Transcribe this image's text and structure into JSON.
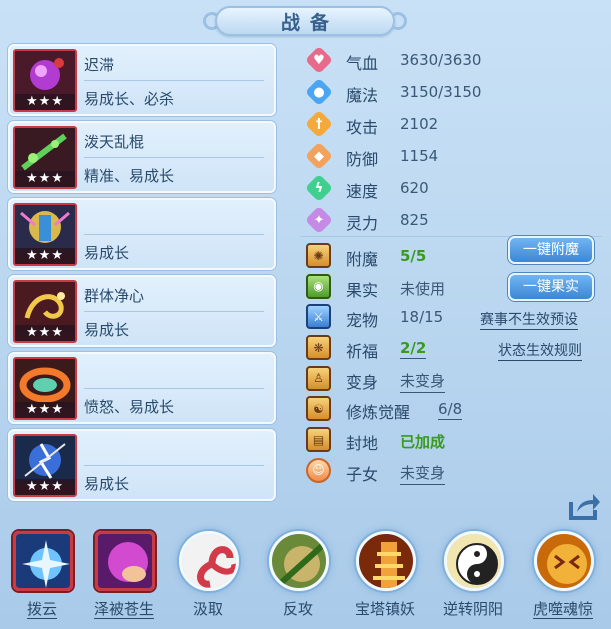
{
  "title": "战备",
  "skills": [
    {
      "name": "迟滞",
      "desc": "易成长、必杀",
      "stars": "★★★",
      "icon": "purple-orb-icon"
    },
    {
      "name": "泼天乱棍",
      "desc": "精准、易成长",
      "stars": "★★★",
      "icon": "green-staff-icon"
    },
    {
      "name": "",
      "desc": "易成长",
      "stars": "★★★",
      "icon": "armored-warrior-icon"
    },
    {
      "name": "群体净心",
      "desc": "易成长",
      "stars": "★★★",
      "icon": "golden-dragon-icon"
    },
    {
      "name": "",
      "desc": "愤怒、易成长",
      "stars": "★★★",
      "icon": "fire-ring-icon"
    },
    {
      "name": "",
      "desc": "易成长",
      "stars": "★★★",
      "icon": "lightning-figure-icon"
    }
  ],
  "stats": [
    {
      "label": "气血",
      "value": "3630/3630",
      "icon": "heart-icon",
      "color": "#e86a8a"
    },
    {
      "label": "魔法",
      "value": "3150/3150",
      "icon": "mana-icon",
      "color": "#4aa6f2"
    },
    {
      "label": "攻击",
      "value": "2102",
      "icon": "sword-icon",
      "color": "#f4a93a"
    },
    {
      "label": "防御",
      "value": "1154",
      "icon": "shield-icon",
      "color": "#f2a25a"
    },
    {
      "label": "速度",
      "value": "620",
      "icon": "lightning-icon",
      "color": "#3fcf8e"
    },
    {
      "label": "灵力",
      "value": "825",
      "icon": "spirit-icon",
      "color": "#c48ae6"
    }
  ],
  "extras": {
    "fumo": {
      "label": "附魔",
      "value": "5/5"
    },
    "guoshi": {
      "label": "果实",
      "value": "未使用"
    },
    "chongwu": {
      "label": "宠物",
      "value": "18/15"
    },
    "qifu": {
      "label": "祈福",
      "value": "2/2"
    },
    "bianshen": {
      "label": "变身",
      "value": "未变身"
    },
    "xiulian": {
      "label": "修炼觉醒",
      "value": "6/8"
    },
    "fengdi": {
      "label": "封地",
      "value": "已加成"
    },
    "zinv": {
      "label": "子女",
      "value": "未变身"
    }
  },
  "buttons": {
    "fumo": "一键附魔",
    "guoshi": "一键果实"
  },
  "links": {
    "preset": "赛事不生效预设",
    "rules": "状态生效规则"
  },
  "bottom_skills": [
    {
      "label": "拨云",
      "icon": "blue-star-icon",
      "underlined": true
    },
    {
      "label": "泽被苍生",
      "icon": "pink-hand-icon",
      "underlined": true
    },
    {
      "label": "汲取",
      "icon": "red-swirl-icon",
      "underlined": false
    },
    {
      "label": "反攻",
      "icon": "green-blade-icon",
      "underlined": false
    },
    {
      "label": "宝塔镇妖",
      "icon": "tower-icon",
      "underlined": false
    },
    {
      "label": "逆转阴阳",
      "icon": "yin-yang-icon",
      "underlined": false
    },
    {
      "label": "虎噬魂惊",
      "icon": "golden-tiger-icon",
      "underlined": true
    }
  ]
}
